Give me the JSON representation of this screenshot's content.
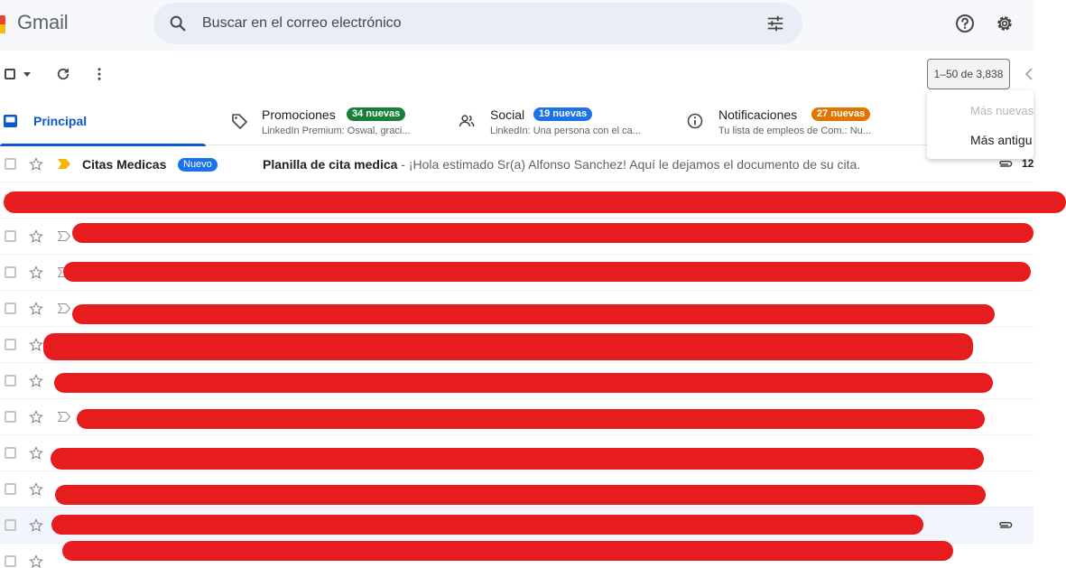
{
  "app": {
    "logo": "Gmail"
  },
  "search": {
    "placeholder": "Buscar en el correo electrónico",
    "search_icon": "search-icon",
    "filter_icon": "tune-icon"
  },
  "header_icons": {
    "help": "help-icon",
    "settings": "gear-icon"
  },
  "toolbar": {
    "pagination": "1–50 de 3,838"
  },
  "sort_menu": {
    "newest": "Más nuevas",
    "oldest": "Más antigu"
  },
  "tabs": [
    {
      "label": "Principal",
      "active": true
    },
    {
      "label": "Promociones",
      "badge": "34 nuevas",
      "badge_color": "#188038",
      "snippet": "LinkedIn Premium: Oswal, graci..."
    },
    {
      "label": "Social",
      "badge": "19 nuevas",
      "badge_color": "#1a73e8",
      "snippet": "LinkedIn: Una persona con el ca..."
    },
    {
      "label": "Notificaciones",
      "badge": "27 nuevas",
      "badge_color": "#e37400",
      "snippet": "Tu lista de empleos de Com.: Nu..."
    }
  ],
  "emails": [
    {
      "sender": "Citas Medicas",
      "badge": "Nuevo",
      "subject": "Planilla de cita medica",
      "snippet": " - ¡Hola estimado Sr(a) Alfonso Sanchez! Aquí le dejamos el documento de su cita.",
      "date": "12",
      "attachment": true
    }
  ],
  "colors": {
    "accent": "#0b57d0",
    "redaction": "#e61c1f",
    "header_bg": "#f6f8fc"
  }
}
